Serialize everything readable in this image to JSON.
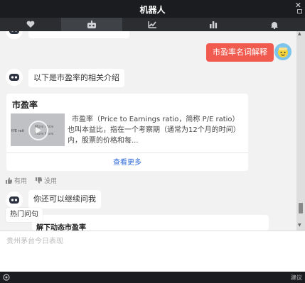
{
  "window": {
    "title": "机器人"
  },
  "tabs": [
    {
      "icon": "heart-icon"
    },
    {
      "icon": "robot-icon"
    },
    {
      "icon": "trend-chart-icon"
    },
    {
      "icon": "bar-chart-icon"
    },
    {
      "icon": "bell-icon"
    }
  ],
  "chat": {
    "user_message": "市盈率名词解释",
    "bot_intro": "以下是市盈率的相关介绍",
    "card": {
      "title": "市盈率",
      "thumb_text_left": "P/E rati",
      "thumb_text_more1": "More More",
      "thumb_text_more2": "More More",
      "description": "市盈率（Price to Earnings ratio，简称 P/E ratio）也叫本益比，指在一个考察期（通常为12个月的时间）内，股票的价格和每...",
      "more_link": "查看更多"
    },
    "feedback": {
      "useful": "有用",
      "useless": "没用"
    },
    "bot_followup": "你还可以继续问我",
    "hot_label": "热门问句",
    "peek_text": "解下动态市盈率"
  },
  "input": {
    "placeholder": "贵州茅台今日表现"
  },
  "statusbar": {
    "suggest": "建议"
  }
}
